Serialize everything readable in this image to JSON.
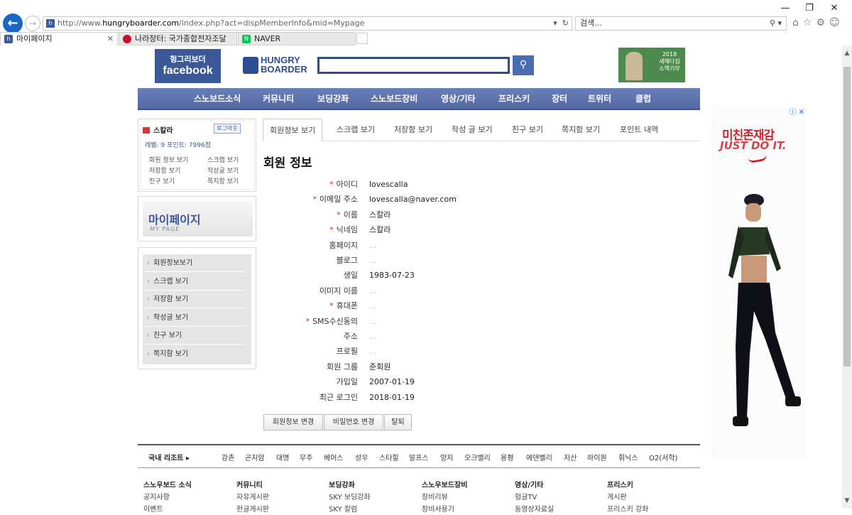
{
  "browser": {
    "url_prefix": "http://www.",
    "url_host": "hungryboarder.com",
    "url_path": "/index.php?act=dispMemberInfo&mid=Mypage",
    "search_placeholder": "검색...",
    "window_controls": [
      "—",
      "❐",
      "✕"
    ],
    "tabs": [
      {
        "label": "마이페이지",
        "icon": "site-favicon",
        "color": "#3b5998"
      },
      {
        "label": "나라장터: 국가종합전자조달",
        "icon": "korea-flag-icon",
        "color": "#c8102e"
      },
      {
        "label": "NAVER",
        "icon": "naver-icon",
        "color": "#03c75a"
      }
    ]
  },
  "header": {
    "fb_line1": "헝그리보더",
    "fb_line2": "facebook",
    "hb_line1": "HUNGRY",
    "hb_line2": "BOARDER",
    "banner_line1": "2018",
    "banner_line2": "새해다짐",
    "banner_line3": "소액기부"
  },
  "mainnav": [
    "스노보드소식",
    "커뮤니티",
    "보딩강좌",
    "스노보드장비",
    "영상/기타",
    "프리스키",
    "장터",
    "트위터",
    "클럽"
  ],
  "login": {
    "username": "스칼라",
    "logout_label": "로그아웃",
    "stats": "레벨: 9   포인트: 7996점",
    "links": [
      "회원 정보 보기",
      "스크랩 보기",
      "저장함 보기",
      "작성글 보기",
      "친구 보기",
      "쪽지함 보기"
    ]
  },
  "mypage": {
    "title": "마이페이지",
    "subtitle": "MY PAGE"
  },
  "sidemenu": [
    "회원정보보기",
    "스크랩 보기",
    "저장함 보기",
    "작성글 보기",
    "친구 보기",
    "쪽지함 보기"
  ],
  "content_tabs": [
    "회원정보 보기",
    "스크랩 보기",
    "저장함 보기",
    "작성 글 보기",
    "친구 보기",
    "쪽지함 보기",
    "포인트 내역"
  ],
  "content_title": "회원 정보",
  "fields": [
    {
      "label": "아이디",
      "required": true,
      "value": "lovescalla"
    },
    {
      "label": "이메일 주소",
      "required": true,
      "value": "lovescalla@naver.com"
    },
    {
      "label": "이름",
      "required": true,
      "value": "스칼라"
    },
    {
      "label": "닉네임",
      "required": true,
      "value": "스칼라"
    },
    {
      "label": "홈페이지",
      "required": false,
      "value": "..."
    },
    {
      "label": "블로그",
      "required": false,
      "value": "..."
    },
    {
      "label": "생일",
      "required": false,
      "value": "1983-07-23"
    },
    {
      "label": "이미지 이름",
      "required": false,
      "value": "..."
    },
    {
      "label": "휴대폰",
      "required": true,
      "value": "..."
    },
    {
      "label": "SMS수신동의",
      "required": true,
      "value": "..."
    },
    {
      "label": "주소",
      "required": false,
      "value": "..."
    },
    {
      "label": "프로필",
      "required": false,
      "value": "..."
    },
    {
      "label": "회원 그룹",
      "required": false,
      "value": "준회원"
    },
    {
      "label": "가입일",
      "required": false,
      "value": "2007-01-19"
    },
    {
      "label": "최근 로그인",
      "required": false,
      "value": "2018-01-19"
    }
  ],
  "required_mark": "*",
  "buttons": [
    "회원정보 변경",
    "비밀번호 변경",
    "탈퇴"
  ],
  "footer": {
    "resorts_title": "국내 리조트",
    "resorts": [
      "강촌",
      "곤지암",
      "대명",
      "무주",
      "베어스",
      "성우",
      "스타힐",
      "알프스",
      "양지",
      "오크밸리",
      "용평",
      "에덴벨리",
      "지산",
      "하이원",
      "휘닉스",
      "O2(서학)"
    ],
    "columns": [
      {
        "title": "스노우보드 소식",
        "links": [
          "공지사항",
          "이벤트"
        ]
      },
      {
        "title": "커뮤니티",
        "links": [
          "자유게시판",
          "펀글게시판"
        ]
      },
      {
        "title": "보딩강좌",
        "links": [
          "SKY 보딩강좌",
          "SKY 칼럼"
        ]
      },
      {
        "title": "스노우보드장비",
        "links": [
          "장비리뷰",
          "장비사용기"
        ]
      },
      {
        "title": "영상/기타",
        "links": [
          "헝글TV",
          "동영상자료실"
        ]
      },
      {
        "title": "프리스키",
        "links": [
          "게시판",
          "프리스키 강좌"
        ]
      }
    ]
  },
  "ad": {
    "line1": "미친존재감",
    "line2": "JUST DO IT."
  }
}
